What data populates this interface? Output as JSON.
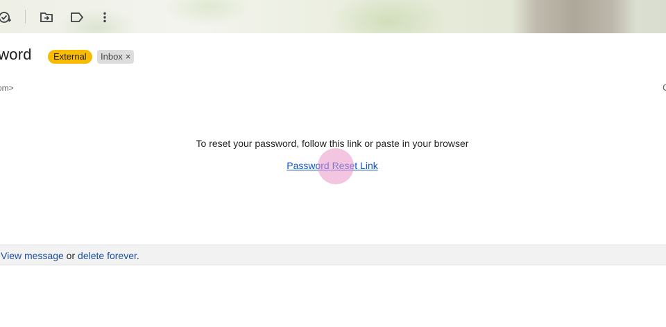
{
  "toolbar": {
    "icons": [
      "snooze-check-icon",
      "move-to-icon",
      "label-icon",
      "more-vert-icon"
    ]
  },
  "email": {
    "subject_fragment": "sword",
    "badge_external": "External",
    "badge_inbox": "Inbox",
    "badge_inbox_remove": "×",
    "sender_fragment": "om>",
    "right_fragment": "C",
    "body_text": "To reset your password, follow this link or paste in your browser",
    "link_text": "Password Reset Link"
  },
  "warning_bar": {
    "view_label": "View message",
    "or_text": " or ",
    "delete_label": "delete forever",
    "period": "."
  },
  "colors": {
    "external_badge": "#f9bb00",
    "link": "#1155cc",
    "warning_link": "#1a4fa0",
    "click_indicator": "#e996c8"
  }
}
